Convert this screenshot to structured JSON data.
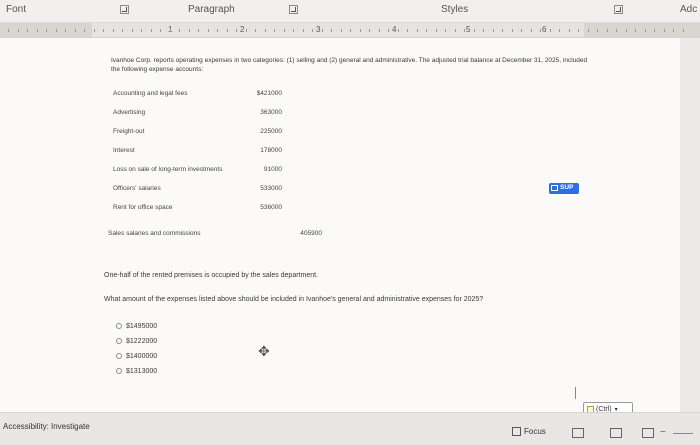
{
  "ribbon": {
    "font_label": "Font",
    "paragraph_label": "Paragraph",
    "styles_label": "Styles",
    "add_label": "Adc"
  },
  "ruler": {
    "numbers": [
      "1",
      "2",
      "3",
      "4",
      "5",
      "6"
    ]
  },
  "question": {
    "intro": "Ivanhoe Corp. reports operating expenses in two categories: (1) selling and (2) general and administrative. The adjusted trial balance at December 31, 2025, included the following expense accounts:",
    "expenses": [
      {
        "label": "Accounting and legal fees",
        "value": "$421000"
      },
      {
        "label": "Advertising",
        "value": "363000"
      },
      {
        "label": "Freight-out",
        "value": "225000"
      },
      {
        "label": "Interest",
        "value": "178000"
      },
      {
        "label": "Loss on sale of long-term investments",
        "value": "91000"
      },
      {
        "label": "Officers' salaries",
        "value": "533000"
      },
      {
        "label": "Rent for office space",
        "value": "536000"
      },
      {
        "label": "Sales salaries and commissions",
        "value": "405900"
      }
    ],
    "note": "One-half of the rented premises is occupied by the sales department.",
    "prompt": "What amount of the expenses listed above should be included in Ivanhoe's general and administrative expenses for 2025?",
    "options": [
      "$1495000",
      "$1222000",
      "$1400000",
      "$1313000"
    ]
  },
  "badge_text": "SUP",
  "paste_options_label": "(Ctrl)",
  "status": {
    "accessibility": "Accessibility: Investigate",
    "focus": "Focus"
  }
}
